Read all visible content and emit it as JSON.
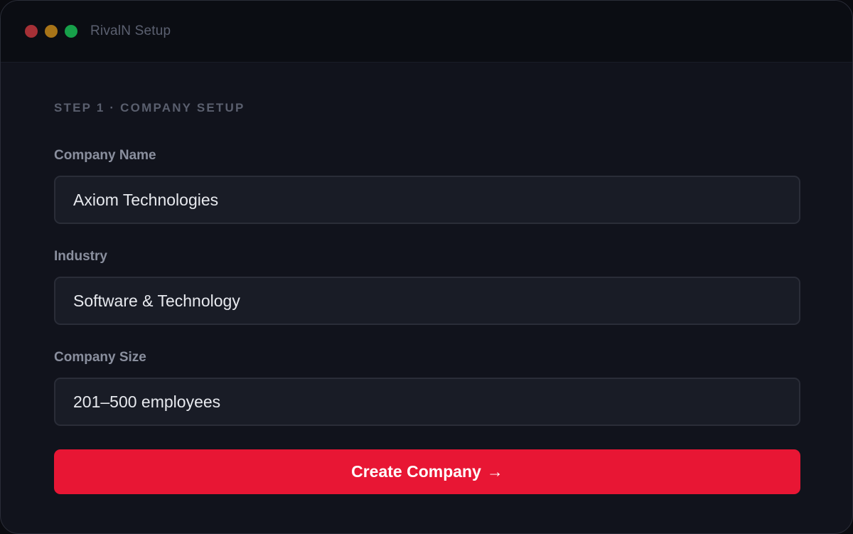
{
  "window": {
    "title": "RivalN Setup",
    "controls": [
      "close",
      "minimize",
      "maximize"
    ]
  },
  "form": {
    "step_label": "STEP 1 · COMPANY SETUP",
    "fields": [
      {
        "label": "Company Name",
        "value": "Axiom Technologies"
      },
      {
        "label": "Industry",
        "value": "Software & Technology"
      },
      {
        "label": "Company Size",
        "value": "201–500 employees"
      }
    ],
    "submit_label": "Create Company",
    "submit_icon": "→"
  },
  "colors": {
    "accent": "#e81634",
    "background": "#11131c",
    "field_bg": "#191c26"
  }
}
